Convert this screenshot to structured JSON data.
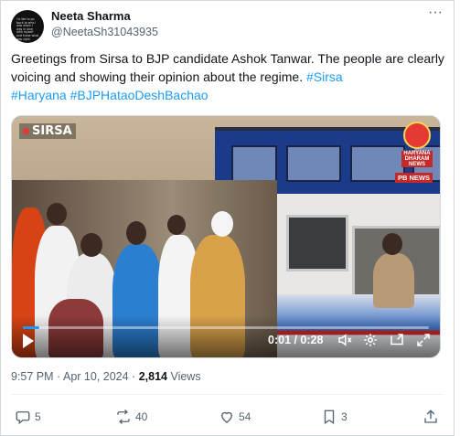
{
  "user": {
    "name": "Neeta Sharma",
    "handle": "@NeetaSh31043935",
    "avatar_text": "I'd like to go back to who I was when I was in love with myself and knew what was right"
  },
  "tweet": {
    "text_plain": "Greetings from Sirsa to BJP candidate Ashok Tanwar.  The people are clearly voicing and showing their opinion about the regime. ",
    "hashtags": [
      "#Sirsa",
      "#Haryana",
      "#BJPHataoDeshBachao"
    ]
  },
  "video": {
    "location_label": "SIRSA",
    "channel_label": "HARYANA\nDHARAM\nNEWS",
    "news_badge": "PB NEWS",
    "time_display": "0:01 / 0:28",
    "progress": 0.04
  },
  "meta": {
    "time": "9:57 PM",
    "date": "Apr 10, 2024",
    "views": "2,814",
    "views_label": "Views"
  },
  "actions": {
    "replies": "5",
    "reposts": "40",
    "likes": "54",
    "bookmarks": "3"
  },
  "icons": [
    "more-icon",
    "play-icon",
    "volume-icon",
    "settings-icon",
    "pip-icon",
    "fullscreen-icon",
    "reply-icon",
    "repost-icon",
    "like-icon",
    "bookmark-icon",
    "share-icon"
  ],
  "colors": {
    "accent": "#1d9bf0",
    "text": "#0f1419",
    "muted": "#536471"
  }
}
